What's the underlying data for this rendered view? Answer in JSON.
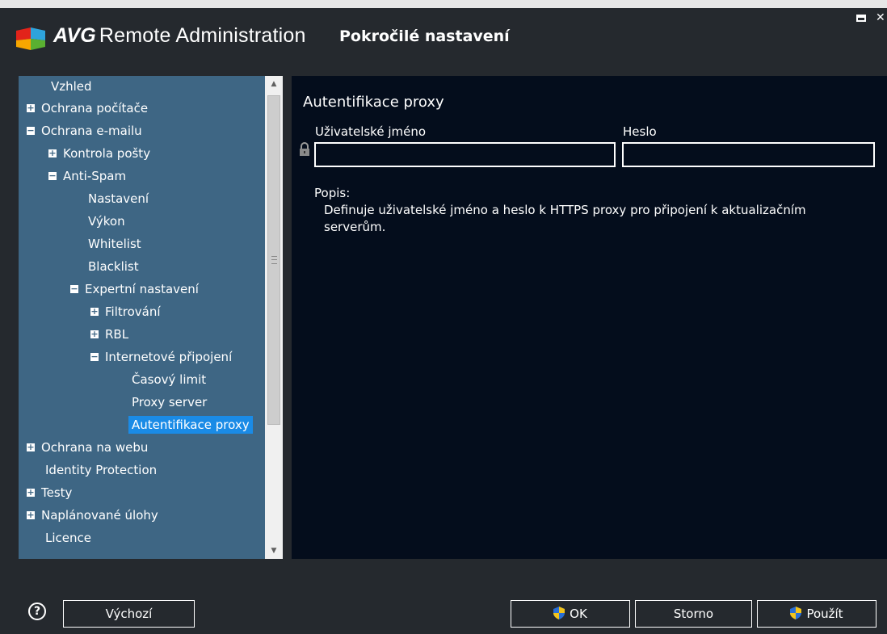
{
  "app": {
    "brand_bold": "AVG",
    "brand_rest": "Remote Administration",
    "page_title": "Pokročilé nastavení"
  },
  "tree": {
    "items": [
      {
        "label": "Vzhled",
        "toggle": ""
      },
      {
        "label": "Ochrana počítače",
        "toggle": "+"
      },
      {
        "label": "Ochrana e-mailu",
        "toggle": "−"
      },
      {
        "label": "Kontrola pošty",
        "toggle": "+"
      },
      {
        "label": "Anti-Spam",
        "toggle": "−"
      },
      {
        "label": "Nastavení",
        "toggle": ""
      },
      {
        "label": "Výkon",
        "toggle": ""
      },
      {
        "label": "Whitelist",
        "toggle": ""
      },
      {
        "label": "Blacklist",
        "toggle": ""
      },
      {
        "label": "Expertní nastavení",
        "toggle": "−"
      },
      {
        "label": "Filtrování",
        "toggle": "+"
      },
      {
        "label": "RBL",
        "toggle": "+"
      },
      {
        "label": "Internetové připojení",
        "toggle": "−"
      },
      {
        "label": "Časový limit",
        "toggle": ""
      },
      {
        "label": "Proxy server",
        "toggle": ""
      },
      {
        "label": "Autentifikace proxy",
        "toggle": "",
        "selected": true
      },
      {
        "label": "Ochrana na webu",
        "toggle": "+"
      },
      {
        "label": "Identity Protection",
        "toggle": ""
      },
      {
        "label": "Testy",
        "toggle": "+"
      },
      {
        "label": "Naplánované úlohy",
        "toggle": "+"
      },
      {
        "label": "Licence",
        "toggle": ""
      }
    ]
  },
  "content": {
    "section_title": "Autentifikace proxy",
    "username_label": "Uživatelské jméno",
    "username_value": "",
    "password_label": "Heslo",
    "password_value": "",
    "description_title": "Popis:",
    "description_text": "Definuje uživatelské jméno a heslo k HTTPS proxy pro připojení k aktualizačním serverům."
  },
  "footer": {
    "help_symbol": "?",
    "default_label": "Výchozí",
    "ok_label": "OK",
    "cancel_label": "Storno",
    "apply_label": "Použít"
  },
  "icons": {
    "logo": "avg-logo-icon",
    "lock": "lock-icon",
    "shield": "uac-shield-icon",
    "help": "help-icon"
  },
  "colors": {
    "window_bg": "#25292e",
    "tree_bg": "#3e6684",
    "content_bg": "#040d1c",
    "selection": "#1a8be6"
  }
}
